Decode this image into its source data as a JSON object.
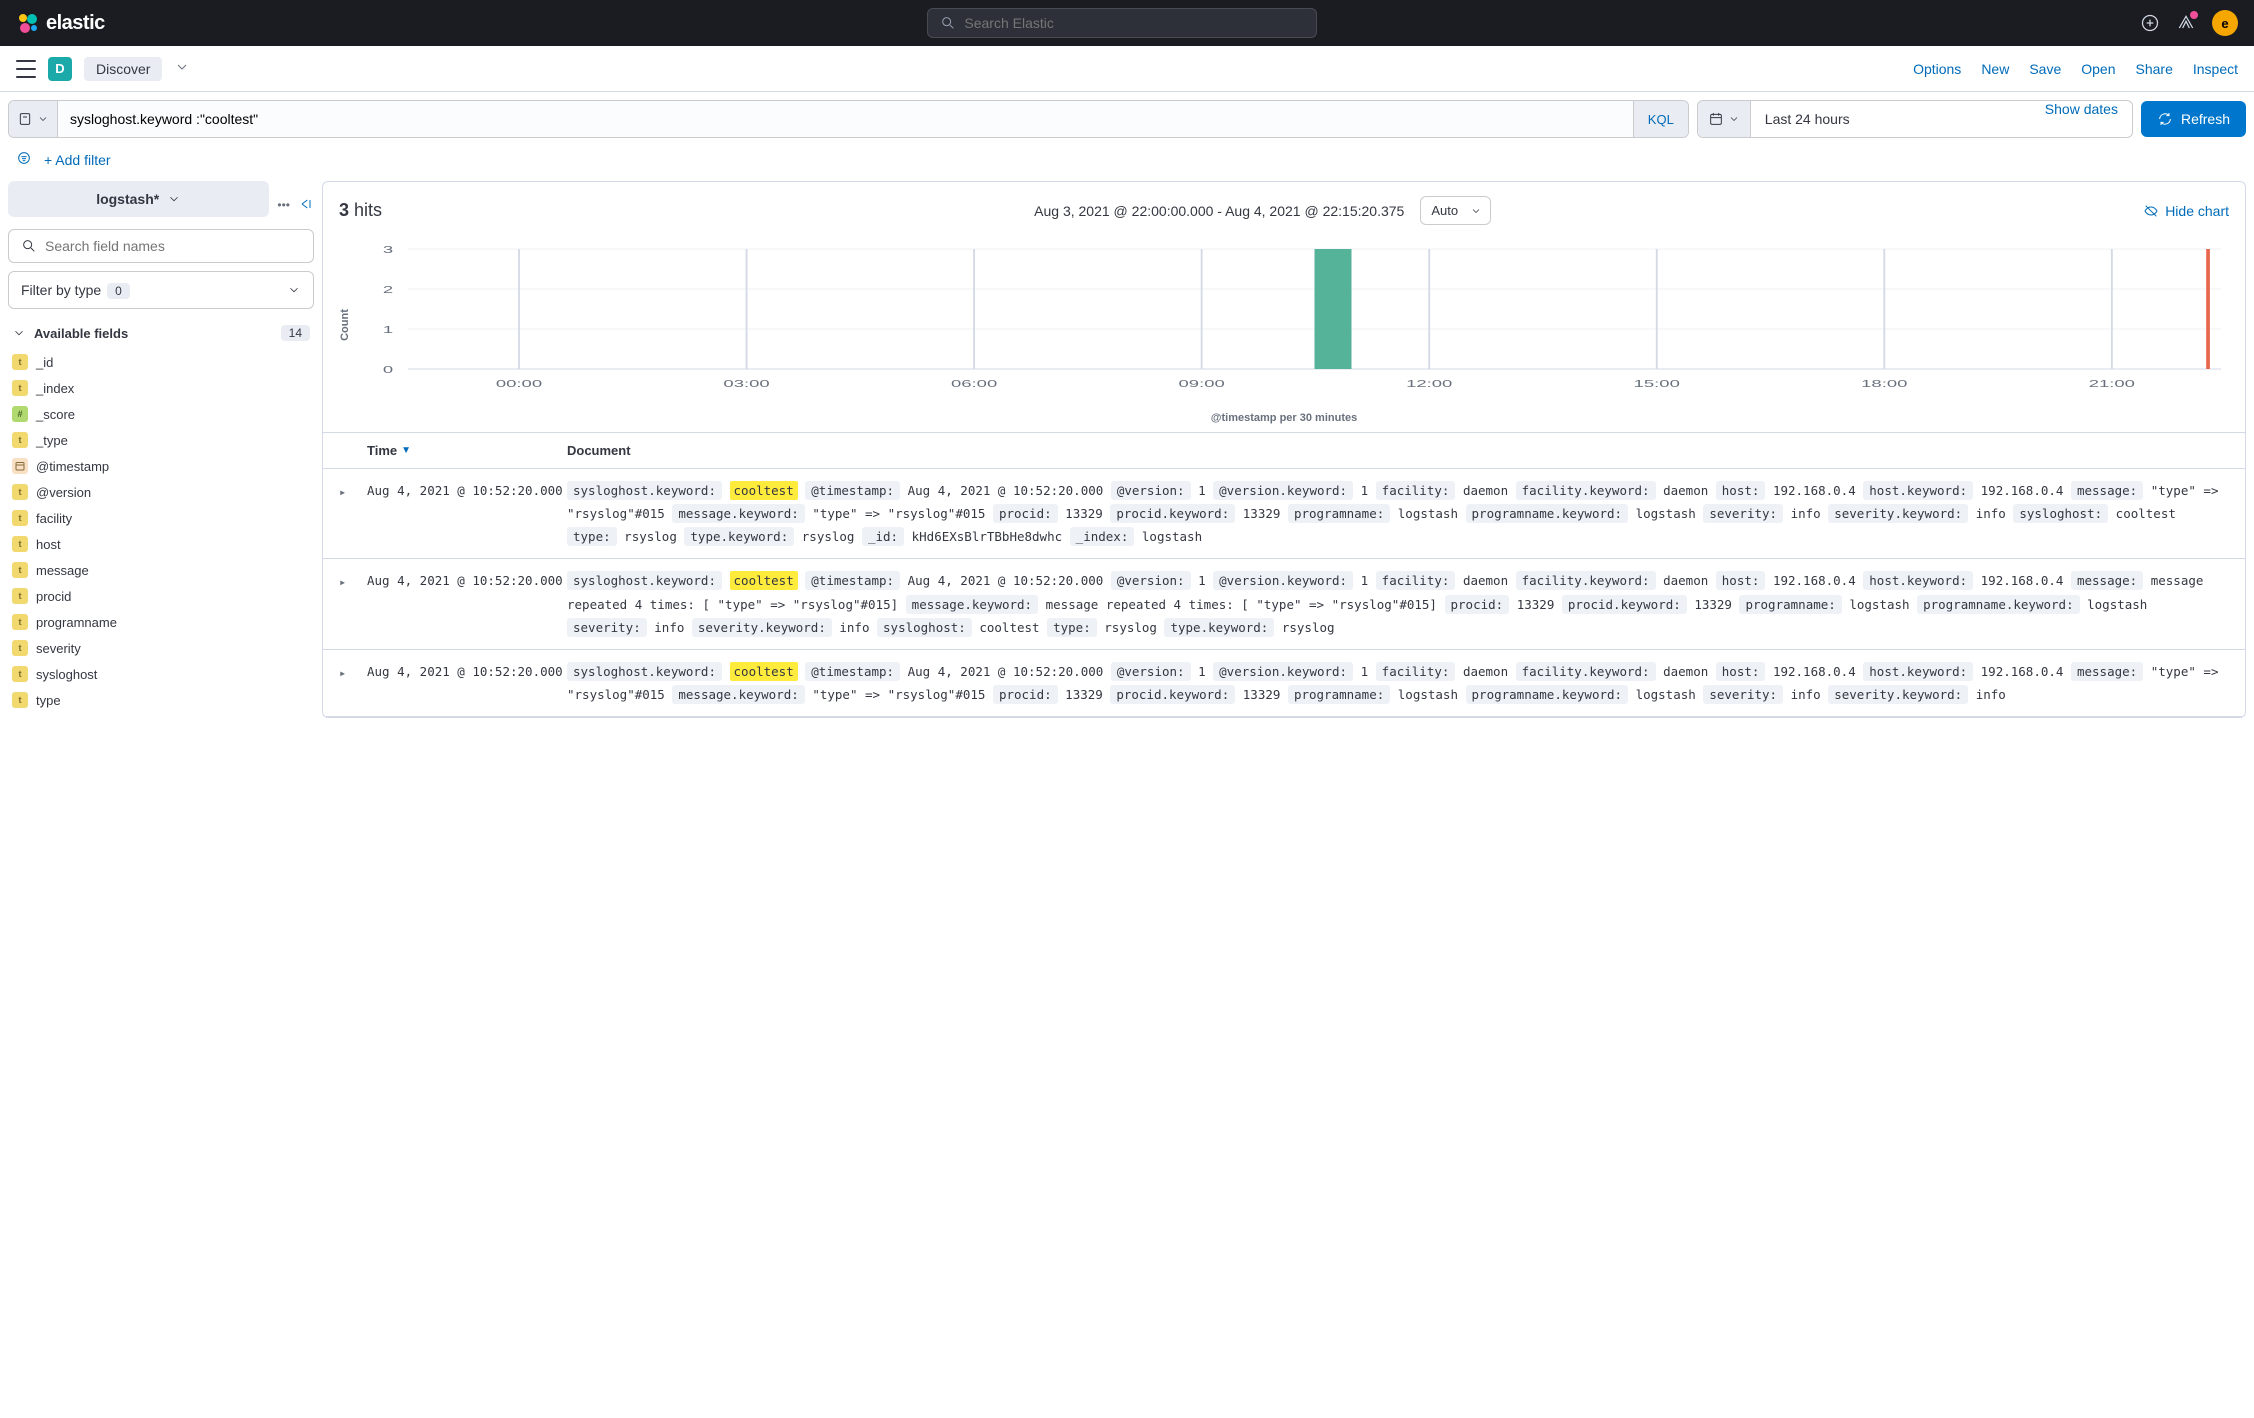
{
  "header": {
    "brand": "elastic",
    "search_placeholder": "Search Elastic",
    "avatar": "e"
  },
  "subheader": {
    "app_letter": "D",
    "app_name": "Discover",
    "links": [
      "Options",
      "New",
      "Save",
      "Open",
      "Share",
      "Inspect"
    ]
  },
  "query": {
    "value": "sysloghost.keyword :\"cooltest\"",
    "kql": "KQL",
    "time_range": "Last 24 hours",
    "show_dates": "Show dates",
    "refresh": "Refresh"
  },
  "filter": {
    "add": "+ Add filter"
  },
  "sidebar": {
    "index_pattern": "logstash*",
    "field_search_placeholder": "Search field names",
    "filter_by_type": "Filter by type",
    "type_count": "0",
    "available_fields": "Available fields",
    "field_count": "14",
    "fields": [
      {
        "type": "t",
        "name": "_id"
      },
      {
        "type": "t",
        "name": "_index"
      },
      {
        "type": "#",
        "name": "_score"
      },
      {
        "type": "t",
        "name": "_type"
      },
      {
        "type": "date",
        "name": "@timestamp"
      },
      {
        "type": "t",
        "name": "@version"
      },
      {
        "type": "t",
        "name": "facility"
      },
      {
        "type": "t",
        "name": "host"
      },
      {
        "type": "t",
        "name": "message"
      },
      {
        "type": "t",
        "name": "procid"
      },
      {
        "type": "t",
        "name": "programname"
      },
      {
        "type": "t",
        "name": "severity"
      },
      {
        "type": "t",
        "name": "sysloghost"
      },
      {
        "type": "t",
        "name": "type"
      }
    ]
  },
  "content": {
    "hits_count": "3",
    "hits_label": "hits",
    "time_range_label": "Aug 3, 2021 @ 22:00:00.000 - Aug 4, 2021 @ 22:15:20.375",
    "interval": "Auto",
    "hide_chart": "Hide chart",
    "y_axis": "Count",
    "x_axis": "@timestamp per 30 minutes",
    "columns": {
      "time": "Time",
      "document": "Document"
    }
  },
  "chart_data": {
    "type": "bar",
    "categories": [
      "00:00",
      "03:00",
      "06:00",
      "09:00",
      "12:00",
      "15:00",
      "18:00",
      "21:00"
    ],
    "x_ticks": [
      "00:00",
      "03:00",
      "06:00",
      "09:00",
      "12:00",
      "15:00",
      "18:00",
      "21:00"
    ],
    "y_ticks": [
      0,
      1,
      2,
      3
    ],
    "ylim": [
      0,
      3
    ],
    "values_by_30min_slot": {
      "10:30": 3
    },
    "title": "@timestamp per 30 minutes",
    "ylabel": "Count"
  },
  "rows": [
    {
      "time": "Aug 4, 2021 @ 10:52:20.000",
      "kv": [
        {
          "k": "sysloghost.keyword:",
          "v": "cooltest",
          "h": true
        },
        {
          "k": "@timestamp:",
          "v": "Aug 4, 2021 @ 10:52:20.000"
        },
        {
          "k": "@version:",
          "v": "1"
        },
        {
          "k": "@version.keyword:",
          "v": "1"
        },
        {
          "k": "facility:",
          "v": "daemon"
        },
        {
          "k": "facility.keyword:",
          "v": "daemon"
        },
        {
          "k": "host:",
          "v": "192.168.0.4"
        },
        {
          "k": "host.keyword:",
          "v": "192.168.0.4"
        },
        {
          "k": "message:",
          "v": "\"type\" => \"rsyslog\"#015"
        },
        {
          "k": "message.keyword:",
          "v": "\"type\" => \"rsyslog\"#015"
        },
        {
          "k": "procid:",
          "v": "13329"
        },
        {
          "k": "procid.keyword:",
          "v": "13329"
        },
        {
          "k": "programname:",
          "v": "logstash"
        },
        {
          "k": "programname.keyword:",
          "v": "logstash"
        },
        {
          "k": "severity:",
          "v": "info"
        },
        {
          "k": "severity.keyword:",
          "v": "info"
        },
        {
          "k": "sysloghost:",
          "v": "cooltest"
        },
        {
          "k": "type:",
          "v": "rsyslog"
        },
        {
          "k": "type.keyword:",
          "v": "rsyslog"
        },
        {
          "k": "_id:",
          "v": "kHd6EXsBlrTBbHe8dwhc"
        },
        {
          "k": "_index:",
          "v": "logstash"
        }
      ]
    },
    {
      "time": "Aug 4, 2021 @ 10:52:20.000",
      "kv": [
        {
          "k": "sysloghost.keyword:",
          "v": "cooltest",
          "h": true
        },
        {
          "k": "@timestamp:",
          "v": "Aug 4, 2021 @ 10:52:20.000"
        },
        {
          "k": "@version:",
          "v": "1"
        },
        {
          "k": "@version.keyword:",
          "v": "1"
        },
        {
          "k": "facility:",
          "v": "daemon"
        },
        {
          "k": "facility.keyword:",
          "v": "daemon"
        },
        {
          "k": "host:",
          "v": "192.168.0.4"
        },
        {
          "k": "host.keyword:",
          "v": "192.168.0.4"
        },
        {
          "k": "message:",
          "v": "message repeated 4 times: [ \"type\" => \"rsyslog\"#015]"
        },
        {
          "k": "message.keyword:",
          "v": "message repeated 4 times: [ \"type\" => \"rsyslog\"#015]"
        },
        {
          "k": "procid:",
          "v": "13329"
        },
        {
          "k": "procid.keyword:",
          "v": "13329"
        },
        {
          "k": "programname:",
          "v": "logstash"
        },
        {
          "k": "programname.keyword:",
          "v": "logstash"
        },
        {
          "k": "severity:",
          "v": "info"
        },
        {
          "k": "severity.keyword:",
          "v": "info"
        },
        {
          "k": "sysloghost:",
          "v": "cooltest"
        },
        {
          "k": "type:",
          "v": "rsyslog"
        },
        {
          "k": "type.keyword:",
          "v": "rsyslog"
        }
      ]
    },
    {
      "time": "Aug 4, 2021 @ 10:52:20.000",
      "kv": [
        {
          "k": "sysloghost.keyword:",
          "v": "cooltest",
          "h": true
        },
        {
          "k": "@timestamp:",
          "v": "Aug 4, 2021 @ 10:52:20.000"
        },
        {
          "k": "@version:",
          "v": "1"
        },
        {
          "k": "@version.keyword:",
          "v": "1"
        },
        {
          "k": "facility:",
          "v": "daemon"
        },
        {
          "k": "facility.keyword:",
          "v": "daemon"
        },
        {
          "k": "host:",
          "v": "192.168.0.4"
        },
        {
          "k": "host.keyword:",
          "v": "192.168.0.4"
        },
        {
          "k": "message:",
          "v": "\"type\" => \"rsyslog\"#015"
        },
        {
          "k": "message.keyword:",
          "v": "\"type\" => \"rsyslog\"#015"
        },
        {
          "k": "procid:",
          "v": "13329"
        },
        {
          "k": "procid.keyword:",
          "v": "13329"
        },
        {
          "k": "programname:",
          "v": "logstash"
        },
        {
          "k": "programname.keyword:",
          "v": "logstash"
        },
        {
          "k": "severity:",
          "v": "info"
        },
        {
          "k": "severity.keyword:",
          "v": "info"
        }
      ]
    }
  ]
}
